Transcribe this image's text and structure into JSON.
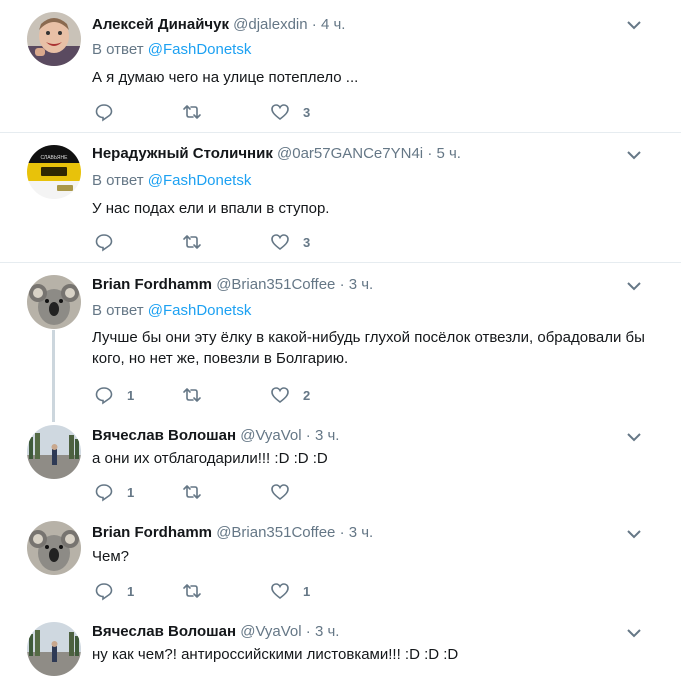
{
  "tweets": [
    {
      "name": "Алексей Динайчук",
      "handle": "@djalexdin",
      "time": "4 ч.",
      "reply_prefix": "В ответ",
      "reply_to": "@FashDonetsk",
      "text": "А я думаю чего на улице потеплело ...",
      "replies": "",
      "retweets": "",
      "likes": "3"
    },
    {
      "name": "Нерадужный Столичник",
      "handle": "@0ar57GANCe7YN4i",
      "time": "5 ч.",
      "reply_prefix": "В ответ",
      "reply_to": "@FashDonetsk",
      "text": "У нас подах  ели и впали в ступор.",
      "replies": "",
      "retweets": "",
      "likes": "3"
    },
    {
      "name": "Brian Fordhamm",
      "handle": "@Brian351Coffee",
      "time": "3 ч.",
      "reply_prefix": "В ответ",
      "reply_to": "@FashDonetsk",
      "text": "Лучше бы они эту ёлку в какой-нибудь глухой посёлок отвезли, обрадовали бы кого, но нет же, повезли в Болгарию.",
      "replies": "1",
      "retweets": "",
      "likes": "2"
    },
    {
      "name": "Вячеслав Волошан",
      "handle": "@VyaVol",
      "time": "3 ч.",
      "text": "а они их отблагодарили!!! :D :D :D",
      "replies": "1",
      "retweets": "",
      "likes": ""
    },
    {
      "name": "Brian Fordhamm",
      "handle": "@Brian351Coffee",
      "time": "3 ч.",
      "text": "Чем?",
      "replies": "1",
      "retweets": "",
      "likes": "1"
    },
    {
      "name": "Вячеслав Волошан",
      "handle": "@VyaVol",
      "time": "3 ч.",
      "text": "ну как чем?! антироссийскими листовками!!! :D :D :D"
    }
  ],
  "icons": {
    "reply": "reply-icon",
    "retweet": "retweet-icon",
    "like": "heart-icon",
    "more": "chevron-down-icon"
  },
  "avatar_banner_text": "СЛАВЬЯНЕ"
}
